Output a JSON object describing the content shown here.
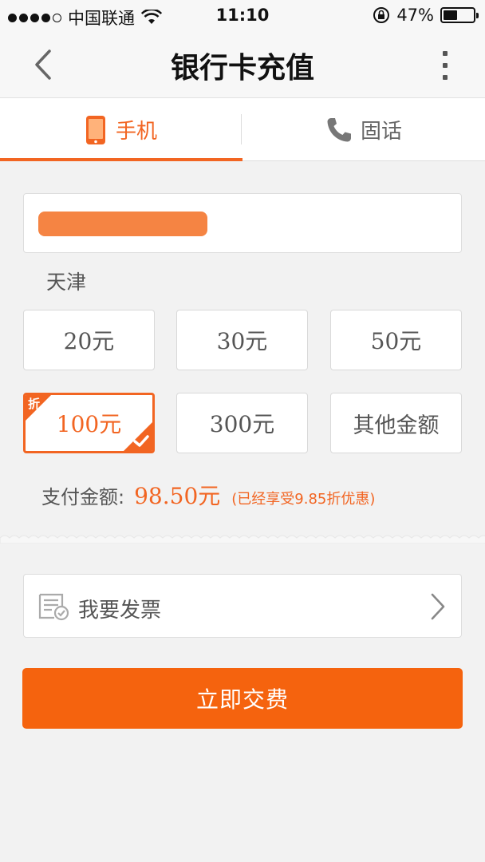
{
  "status_bar": {
    "carrier": "中国联通",
    "time": "11:10",
    "battery_text": "47%",
    "battery_level": 0.47
  },
  "nav": {
    "title": "银行卡充值"
  },
  "tabs": [
    {
      "label": "手机",
      "icon": "mobile-phone-icon",
      "active": true
    },
    {
      "label": "固话",
      "icon": "telephone-icon",
      "active": false
    }
  ],
  "phone_input": {
    "region": "天津"
  },
  "amounts": [
    {
      "label": "20元"
    },
    {
      "label": "30元"
    },
    {
      "label": "50元"
    },
    {
      "label": "100元",
      "selected": true,
      "badge": "折"
    },
    {
      "label": "300元"
    },
    {
      "label": "其他金额"
    }
  ],
  "payment": {
    "label": "支付金额:",
    "value": "98.50元",
    "note": "(已经享受9.85折优惠)"
  },
  "invoice": {
    "label": "我要发票"
  },
  "submit": {
    "label": "立即交费"
  },
  "colors": {
    "accent": "#f26522",
    "button": "#f5630e",
    "background": "#f2f2f2"
  }
}
